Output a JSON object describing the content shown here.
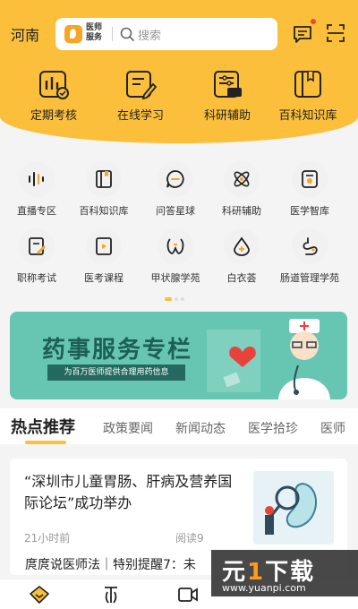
{
  "header": {
    "city": "河南",
    "search_brand": "医师服务",
    "search_placeholder": "搜索",
    "accent": "#fbbf3b"
  },
  "header_nav": [
    {
      "label": "定期考核",
      "icon": "exam-chart-icon"
    },
    {
      "label": "在线学习",
      "icon": "online-learning-icon"
    },
    {
      "label": "科研辅助",
      "icon": "research-icon"
    },
    {
      "label": "百科知识库",
      "icon": "encyclopedia-icon"
    }
  ],
  "grid": [
    {
      "label": "直播专区",
      "icon": "live-stream-icon"
    },
    {
      "label": "百科知识库",
      "icon": "book-icon"
    },
    {
      "label": "问答星球",
      "icon": "qa-bubble-icon"
    },
    {
      "label": "科研辅助",
      "icon": "atom-icon"
    },
    {
      "label": "医学智库",
      "icon": "think-tank-icon"
    },
    {
      "label": "职称考试",
      "icon": "title-exam-icon"
    },
    {
      "label": "医考课程",
      "icon": "course-icon"
    },
    {
      "label": "甲状腺学苑",
      "icon": "thyroid-icon"
    },
    {
      "label": "白衣荟",
      "icon": "drop-icon"
    },
    {
      "label": "肠道管理学苑",
      "icon": "intestine-icon"
    }
  ],
  "banner": {
    "title": "药事服务专栏",
    "subtitle": "为百万医师提供合理用药信息"
  },
  "tabs": [
    "热点推荐",
    "政策要闻",
    "新闻动态",
    "医学拾珍",
    "医师"
  ],
  "articles": [
    {
      "title": "“深圳市儿童胃肠、肝病及营养国际论坛”成功举办",
      "time": "21小时前",
      "reads": "阅读9"
    },
    {
      "title": "庹庹说医师法｜特别提醒7：未"
    }
  ],
  "bottom_nav": [
    {
      "icon": "home-icon",
      "color": "#fbbf3b"
    },
    {
      "icon": "library-icon"
    },
    {
      "icon": "video-icon"
    }
  ],
  "watermark": {
    "brand_1": "元",
    "brand_o": "1",
    "brand_2": "下载",
    "url": "www.yuanpi.com"
  }
}
